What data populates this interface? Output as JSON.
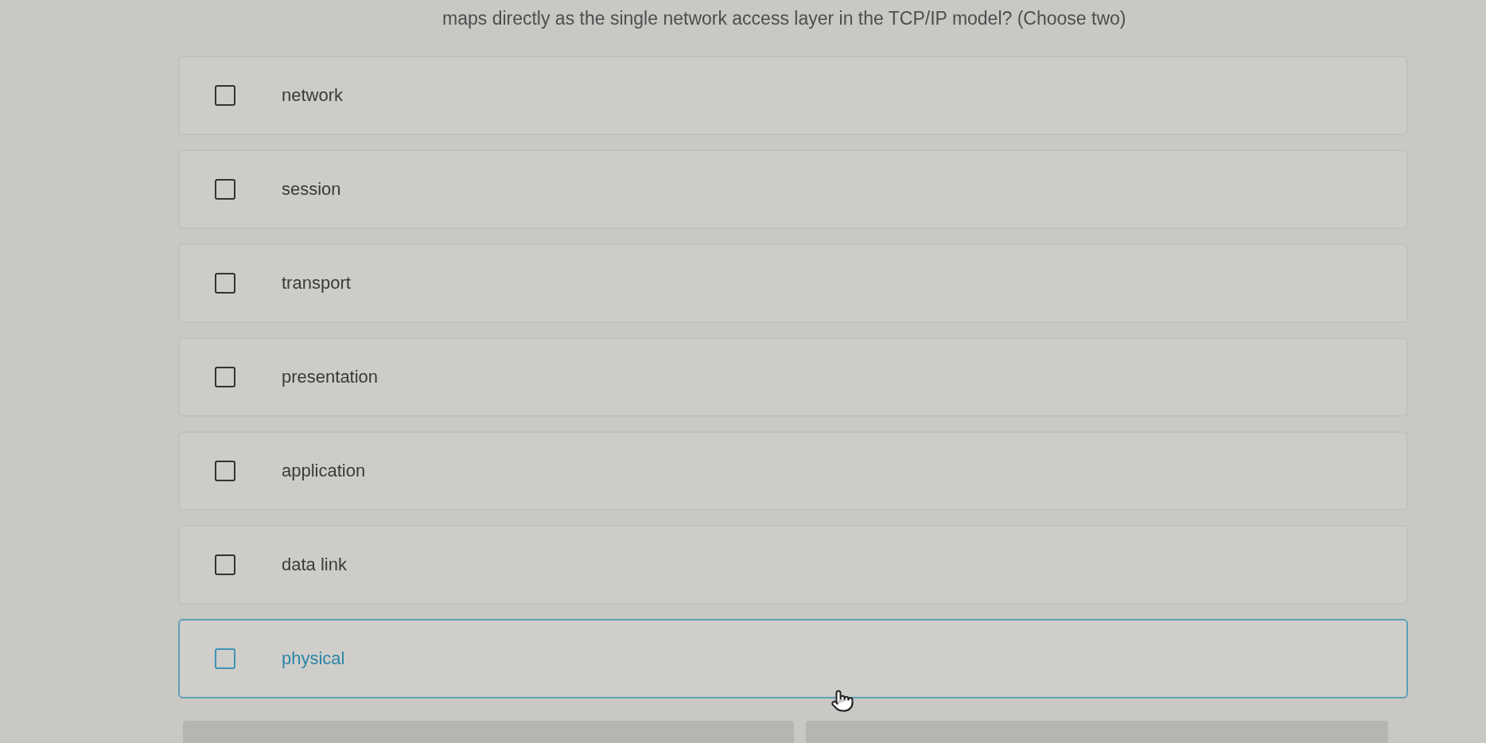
{
  "question": {
    "text": "maps directly as the single network access layer in the TCP/IP model? (Choose two)"
  },
  "options": [
    {
      "label": "network",
      "checked": false,
      "hovered": false
    },
    {
      "label": "session",
      "checked": false,
      "hovered": false
    },
    {
      "label": "transport",
      "checked": false,
      "hovered": false
    },
    {
      "label": "presentation",
      "checked": false,
      "hovered": false
    },
    {
      "label": "application",
      "checked": false,
      "hovered": false
    },
    {
      "label": "data link",
      "checked": false,
      "hovered": false
    },
    {
      "label": "physical",
      "checked": false,
      "hovered": true
    }
  ],
  "cursor": {
    "kind": "hand"
  },
  "footer_buttons": [
    {
      "kind": "button"
    },
    {
      "kind": "button"
    }
  ]
}
